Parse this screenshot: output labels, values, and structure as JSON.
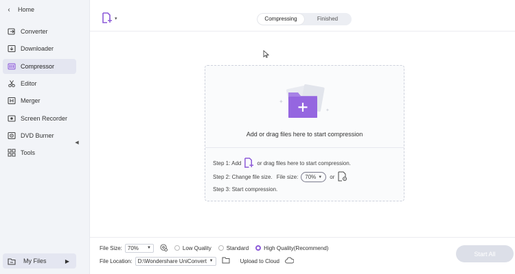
{
  "sidebar": {
    "home_label": "Home",
    "items": [
      {
        "label": "Converter",
        "icon": "converter-icon"
      },
      {
        "label": "Downloader",
        "icon": "downloader-icon"
      },
      {
        "label": "Compressor",
        "icon": "compressor-icon",
        "active": true
      },
      {
        "label": "Editor",
        "icon": "scissors-icon"
      },
      {
        "label": "Merger",
        "icon": "merger-icon"
      },
      {
        "label": "Screen Recorder",
        "icon": "screen-recorder-icon"
      },
      {
        "label": "DVD Burner",
        "icon": "dvd-icon"
      },
      {
        "label": "Tools",
        "icon": "tools-grid-icon"
      }
    ],
    "my_files_label": "My Files"
  },
  "header": {
    "tabs": [
      {
        "label": "Compressing",
        "active": true
      },
      {
        "label": "Finished",
        "active": false
      }
    ]
  },
  "dropzone": {
    "main_text": "Add or drag files here to start compression",
    "step1_prefix": "Step 1: Add",
    "step1_suffix": "or drag files here to start compression.",
    "step2_prefix": "Step 2: Change file size.",
    "step2_file_size_label": "File size:",
    "step2_value": "70%",
    "step2_or": "or",
    "step3": "Step 3: Start compression."
  },
  "bottom": {
    "file_size_label": "File Size:",
    "file_size_value": "70%",
    "quality_options": [
      {
        "label": "Low Quality",
        "selected": false
      },
      {
        "label": "Standard",
        "selected": false
      },
      {
        "label": "High Quality(Recommend)",
        "selected": true
      }
    ],
    "file_location_label": "File Location:",
    "file_location_value": "D:\\Wondershare UniConverter",
    "upload_label": "Upload to Cloud",
    "start_all_label": "Start All"
  },
  "colors": {
    "accent": "#8c5ad8",
    "sidebar_bg": "#f2f4f8",
    "disabled_button": "#dcdfe8"
  }
}
